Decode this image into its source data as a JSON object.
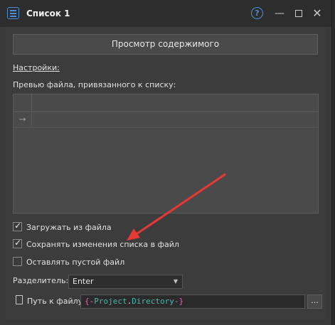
{
  "window": {
    "title": "Список 1",
    "help_label": "?",
    "minimize_label": "—",
    "close_label": "✕"
  },
  "preview_button": {
    "label": "Просмотр содержимого"
  },
  "settings": {
    "link": "Настройки:"
  },
  "preview": {
    "label": "Превью файла, привязанного к списку:",
    "row_marker": "→"
  },
  "options": {
    "load_from_file": {
      "label": "Загружать из файла",
      "checked": true
    },
    "save_changes": {
      "label": "Сохранять изменения списка в файл",
      "checked": true
    },
    "leave_empty": {
      "label": "Оставлять пустой файл",
      "checked": false
    }
  },
  "check_glyph": "✓",
  "separator": {
    "label": "Разделитель:",
    "value": "Enter"
  },
  "path": {
    "label": "Путь к файлу",
    "value_open": "{-",
    "value_part1": "Project",
    "value_dot": ".",
    "value_part2": "Directory",
    "value_close": "-}",
    "browse_label": "..."
  },
  "colors": {
    "accent_blue": "#4c8fd6",
    "annotation_arrow": "#e53935",
    "variable_brace": "#d66aa6",
    "variable_name": "#4db6ac"
  }
}
